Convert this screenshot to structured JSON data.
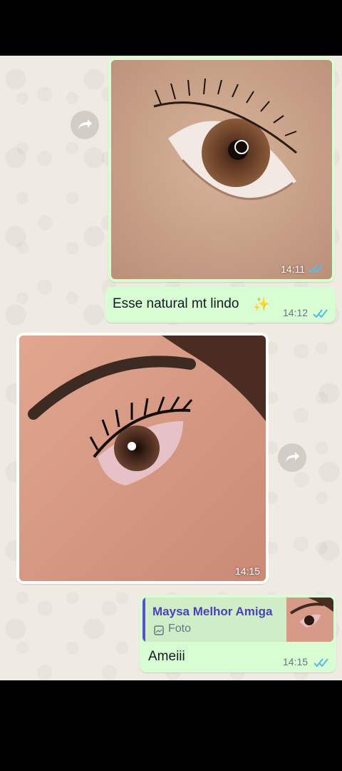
{
  "messages": [
    {
      "kind": "image",
      "direction": "outgoing",
      "time": "14:11",
      "status_icon": "double-check-read-icon"
    },
    {
      "kind": "text",
      "direction": "outgoing",
      "text": "Esse natural mt lindo",
      "emoji": "✨",
      "time": "14:12",
      "status_icon": "double-check-read-icon"
    },
    {
      "kind": "image",
      "direction": "incoming",
      "time": "14:15"
    },
    {
      "kind": "reply",
      "direction": "outgoing",
      "quote_author": "Maysa Melhor Amiga",
      "quote_type": "Foto",
      "text": "Ameiii",
      "time": "14:15",
      "status_icon": "double-check-read-icon"
    }
  ],
  "colors": {
    "outgoing_bubble": "#d9fdd3",
    "incoming_bubble": "#ffffff",
    "read_ticks": "#53bdeb",
    "quote_author": "#4b3fc0",
    "chat_background": "#efeae2"
  },
  "icons": {
    "forward": "forward-arrow-icon",
    "loading": "loading-spinner-icon",
    "photo": "camera-photo-icon",
    "read": "double-check-read-icon"
  }
}
